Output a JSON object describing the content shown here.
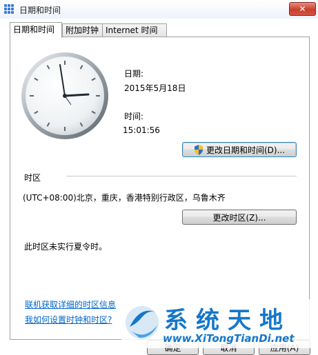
{
  "window": {
    "title": "日期和时间",
    "close_label": "✕"
  },
  "tabs": [
    {
      "label": "日期和时间",
      "active": true
    },
    {
      "label": "附加时钟",
      "active": false
    },
    {
      "label": "Internet 时间",
      "active": false
    }
  ],
  "datetime": {
    "date_label": "日期:",
    "date_value": "2015年5月18日",
    "time_label": "时间:",
    "time_value": "15:01:56",
    "change_button": "更改日期和时间(D)..."
  },
  "timezone": {
    "section_label": "时区",
    "value": "(UTC+08:00)北京，重庆，香港特别行政区，乌鲁木齐",
    "change_button": "更改时区(Z)...",
    "dst_note": "此时区未实行夏令时。"
  },
  "links": {
    "online_info": "联机获取详细的时区信息",
    "how_to": "我如何设置时钟和时区?"
  },
  "buttons": {
    "ok": "确定",
    "cancel": "取消",
    "apply": "应用(A)"
  },
  "watermark": {
    "text": "系统天地",
    "url": "www.XiTongTianDi.net"
  },
  "colors": {
    "link": "#0066cc",
    "close": "#c7402f",
    "watermark": "#1577c9"
  }
}
